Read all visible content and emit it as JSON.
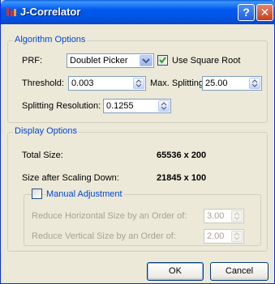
{
  "window": {
    "title": "J-Correlator",
    "help_glyph": "?",
    "close_glyph": "✕"
  },
  "algorithm": {
    "legend": "Algorithm Options",
    "prf_label": "PRF:",
    "prf_value": "Doublet Picker",
    "sqrt_label": "Use Square Root",
    "sqrt_checked": true,
    "threshold_label": "Threshold:",
    "threshold_value": "0.003",
    "max_split_label": "Max. Splitting:",
    "max_split_value": "25.00",
    "split_res_label": "Splitting Resolution:",
    "split_res_value": "0.1255"
  },
  "display": {
    "legend": "Display Options",
    "total_size_label": "Total Size:",
    "total_size_value": "65536 x 200",
    "scaled_size_label": "Size after Scaling Down:",
    "scaled_size_value": "21845 x 100",
    "manual": {
      "legend": "Manual Adjustment",
      "checked": false,
      "horiz_label": "Reduce Horizontal Size by an Order of:",
      "horiz_value": "3.00",
      "vert_label": "Reduce Vertical Size by an Order of:",
      "vert_value": "2.00"
    }
  },
  "buttons": {
    "ok": "OK",
    "cancel": "Cancel"
  },
  "colors": {
    "titlebar": "#0055e5",
    "legend_text": "#0046d5",
    "dialog_bg": "#ece9d8"
  }
}
